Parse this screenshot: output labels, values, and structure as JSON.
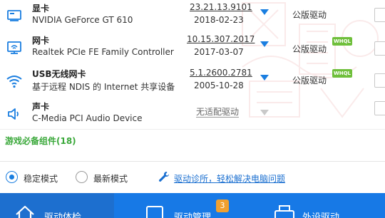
{
  "drivers": [
    {
      "category": "显卡",
      "device": "NVIDIA GeForce GT 610",
      "version": "23.21.13.9101",
      "date": "2018-02-23",
      "type": "公版驱动",
      "whql": false,
      "icon": "display-icon"
    },
    {
      "category": "网卡",
      "device": "Realtek PCIe FE Family Controller",
      "version": "10.15.307.2017",
      "date": "2017-03-07",
      "type": "公版驱动",
      "whql": true,
      "whql_label": "WHQL",
      "icon": "network-card-icon"
    },
    {
      "category": "USB无线网卡",
      "device": "基于远程 NDIS 的 Internet 共享设备",
      "version": "5.1.2600.2781",
      "date": "2005-10-28",
      "type": "公版驱动",
      "whql": true,
      "whql_label": "WHQL",
      "icon": "wifi-icon"
    },
    {
      "category": "声卡",
      "device": "C-Media PCI Audio Device",
      "version": "无适配驱动",
      "date": "",
      "type": "",
      "whql": false,
      "icon": "speaker-icon"
    }
  ],
  "section": {
    "title": "游戏必备组件(18)"
  },
  "modes": {
    "stable_label": "稳定模式",
    "latest_label": "最新模式",
    "selected": "stable",
    "help_link": "驱动诊所，轻松解决电脑问题"
  },
  "nav": {
    "tabs": [
      {
        "label": "驱动体检",
        "icon": "home-icon",
        "active": true
      },
      {
        "label": "驱动管理",
        "icon": "manage-icon",
        "badge": "3"
      },
      {
        "label": "外设驱动",
        "icon": "printer-icon"
      }
    ]
  },
  "colors": {
    "accent": "#1779e6",
    "green": "#3aa83a",
    "whql": "#6fbf3b",
    "badge": "#f0a030"
  }
}
